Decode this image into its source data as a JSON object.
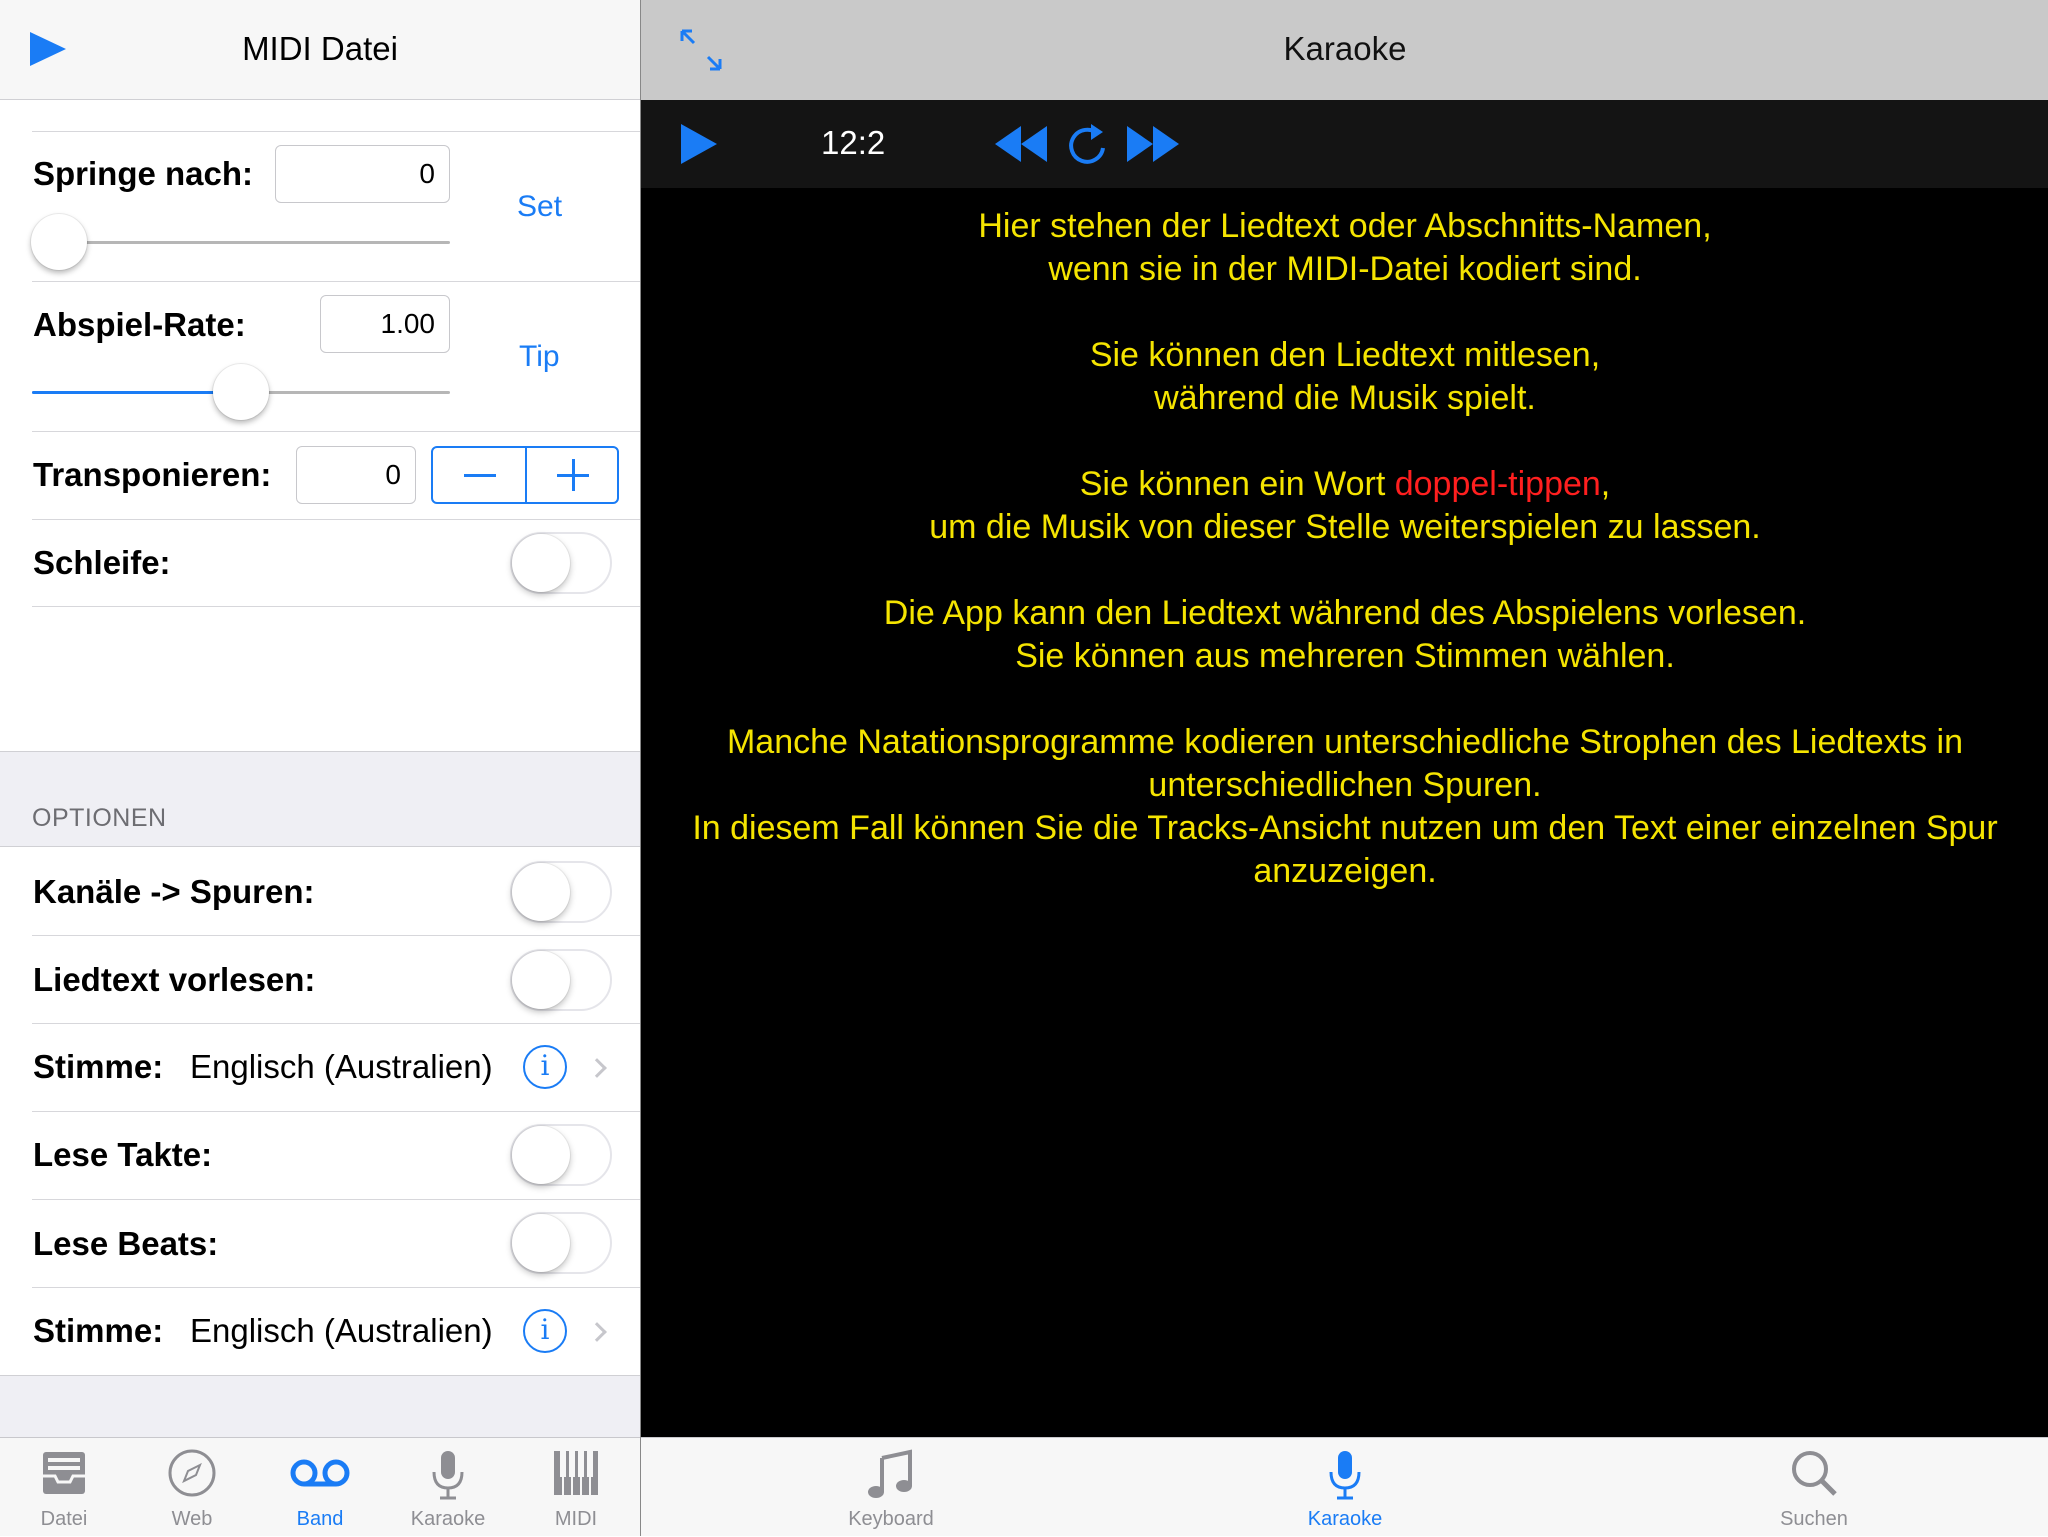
{
  "left": {
    "title": "MIDI Datei",
    "rows": {
      "jump_label": "Springe nach:",
      "jump_value": "0",
      "set_label": "Set",
      "rate_label": "Abspiel-Rate:",
      "rate_value": "1.00",
      "rate_slider_fraction": 0.5,
      "tip_label": "Tip",
      "transpose_label": "Transponieren:",
      "transpose_value": "0",
      "loop_label": "Schleife:"
    },
    "options": {
      "header": "OPTIONEN",
      "channels_label": "Kanäle -> Spuren:",
      "read_lyrics_label": "Liedtext vorlesen:",
      "voice_label": "Stimme:",
      "voice_value": "Englisch (Australien)",
      "read_bars_label": "Lese Takte:",
      "read_beats_label": "Lese Beats:",
      "voice2_label": "Stimme:",
      "voice2_value": "Englisch (Australien)"
    },
    "tabs": [
      {
        "label": "Datei",
        "icon": "tray-icon",
        "active": false
      },
      {
        "label": "Web",
        "icon": "compass-icon",
        "active": false
      },
      {
        "label": "Band",
        "icon": "voicemail-icon",
        "active": true
      },
      {
        "label": "Karaoke",
        "icon": "microphone-icon",
        "active": false
      },
      {
        "label": "MIDI",
        "icon": "piano-icon",
        "active": false
      }
    ]
  },
  "right": {
    "title": "Karaoke",
    "time": "12:2",
    "lyrics": {
      "p1_l1": "Hier stehen der Liedtext oder Abschnitts-Namen,",
      "p1_l2": "wenn sie in der MIDI-Datei kodiert sind.",
      "p2_l1": "Sie können den Liedtext mitlesen,",
      "p2_l2": "während die Musik spielt.",
      "p3_pre": "Sie können ein Wort ",
      "p3_red": "doppel-tippen",
      "p3_post": ",",
      "p3_l2": "um die Musik von dieser Stelle weiterspielen zu lassen.",
      "p4_l1": "Die App kann den Liedtext während des Abspielens vorlesen.",
      "p4_l2": "Sie können aus mehreren Stimmen wählen.",
      "p5_l1": "Manche Natationsprogramme kodieren unterschiedliche Strophen des Liedtexts in",
      "p5_l2": "unterschiedlichen Spuren.",
      "p5_l3": "In diesem Fall können Sie die Tracks-Ansicht nutzen um den Text einer einzelnen Spur",
      "p5_l4": "anzuzeigen."
    },
    "tabs": [
      {
        "label": "Keyboard",
        "icon": "music-note-icon",
        "active": false
      },
      {
        "label": "Karaoke",
        "icon": "microphone-icon",
        "active": true
      },
      {
        "label": "Suchen",
        "icon": "search-icon",
        "active": false
      }
    ]
  },
  "colors": {
    "accent": "#1a7cf5",
    "lyrics": "#f5e400",
    "highlight": "#ff1f1f"
  }
}
